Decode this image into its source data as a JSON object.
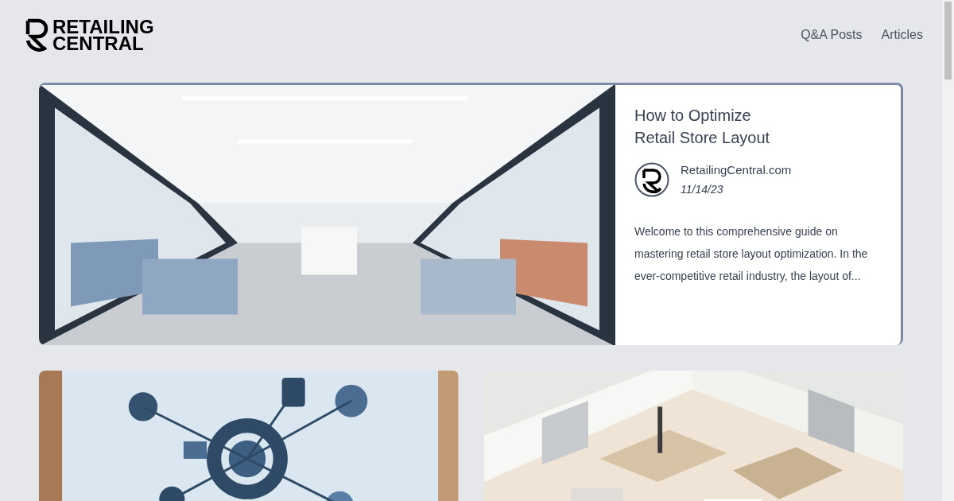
{
  "header": {
    "logo_lines": [
      "RETAILING",
      "CENTRAL"
    ],
    "nav": [
      {
        "label": "Q&A Posts"
      },
      {
        "label": "Articles"
      }
    ]
  },
  "featured": {
    "title_lines": [
      "How to Optimize",
      "Retail Store Layout"
    ],
    "author": "RetailingCentral.com",
    "date": "11/14/23",
    "excerpt": "Welcome to this comprehensive guide on mastering retail store layout optimization. In the ever-competitive retail industry, the layout of..."
  }
}
